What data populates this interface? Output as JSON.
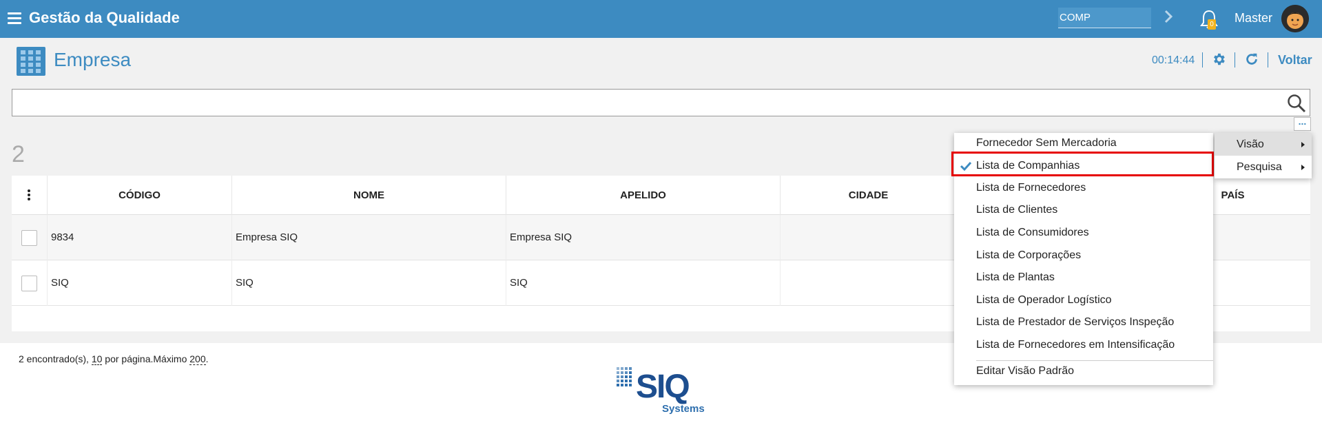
{
  "header": {
    "app_title": "Gestão da Qualidade",
    "company_value": "COMP",
    "notification_count": "0",
    "user_name": "Master"
  },
  "page": {
    "title": "Empresa",
    "timer": "00:14:44",
    "back_label": "Voltar"
  },
  "search": {
    "value": "",
    "placeholder": ""
  },
  "results": {
    "count": "2",
    "columns": [
      "CÓDIGO",
      "NOME",
      "APELIDO",
      "CIDADE",
      "PAÍS"
    ],
    "rows": [
      {
        "codigo": "9834",
        "nome": "Empresa SIQ",
        "apelido": "Empresa SIQ",
        "cidade": "",
        "pais": ""
      },
      {
        "codigo": "SIQ",
        "nome": "SIQ",
        "apelido": "SIQ",
        "cidade": "",
        "pais": ""
      }
    ],
    "footer": {
      "found": "2 encontrado(s), ",
      "per_page": "10",
      "per_page_suffix": " por página.Máximo ",
      "max": "200",
      "end": "."
    }
  },
  "view_menu": {
    "items": [
      "Fornecedor Sem Mercadoria",
      "Lista de Companhias",
      "Lista de Fornecedores",
      "Lista de Clientes",
      "Lista de Consumidores",
      "Lista de Corporações",
      "Lista de Plantas",
      "Lista de Operador Logístico",
      "Lista de Prestador de Serviços Inspeção",
      "Lista de Fornecedores em Intensificação"
    ],
    "selected_index": 1,
    "edit_default": "Editar Visão Padrão"
  },
  "submenu": {
    "items": [
      "Visão",
      "Pesquisa"
    ],
    "active_index": 0
  },
  "logo": {
    "text": "SIQ",
    "subtext": "Systems"
  },
  "colors": {
    "primary": "#3d8bc1",
    "highlight_border": "#e60000",
    "badge": "#f2b31e"
  },
  "icons": [
    "hamburger-icon",
    "chevron-right-icon",
    "bell-icon",
    "building-icon",
    "gear-icon",
    "refresh-icon",
    "search-icon",
    "kebab-icon",
    "check-icon",
    "caret-right-icon"
  ]
}
